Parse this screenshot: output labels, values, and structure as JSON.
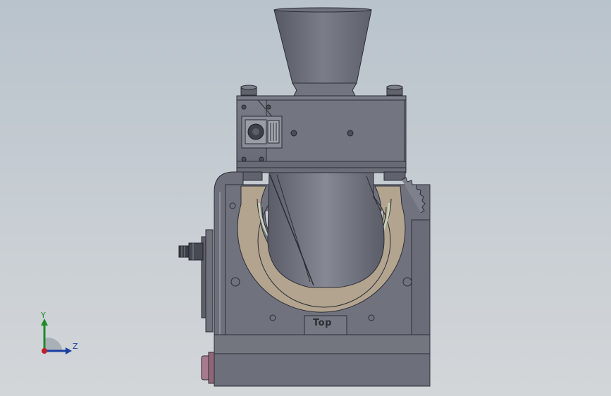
{
  "viewport": {
    "background_top": "#b9c3cc",
    "background_bottom": "#d3d6d9"
  },
  "model": {
    "engraved_text": "Top",
    "body_color": "#6e707c",
    "bearing_ring_color": "#b5a690",
    "knurl_knob_color": "#a87a8e"
  },
  "triad": {
    "y_label": "Y",
    "z_label": "Z",
    "y_color": "#1f8a2a",
    "z_color": "#1a3fa0",
    "origin_color": "#c0202a"
  }
}
